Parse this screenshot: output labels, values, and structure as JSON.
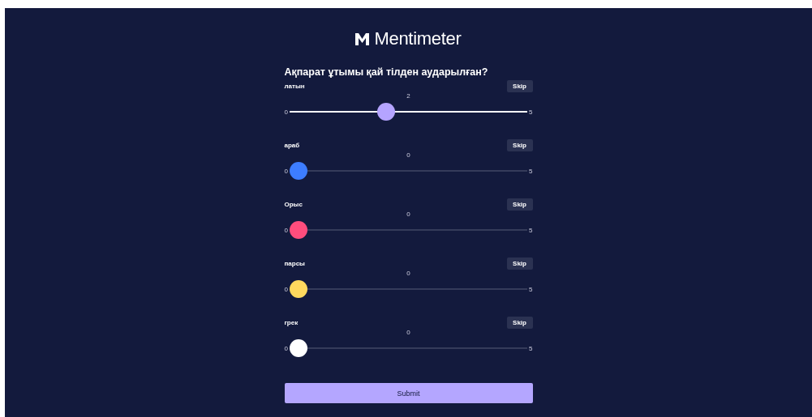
{
  "logo": {
    "text": "Mentimeter"
  },
  "question": "Ақпарат ұтымы қай тілден аударылған?",
  "sliders": [
    {
      "label": "латын",
      "skip": "Skip",
      "value": "2",
      "min": "0",
      "max": "5",
      "level": 0.4,
      "touched": true,
      "color": "#b5a4ff"
    },
    {
      "label": "араб",
      "skip": "Skip",
      "value": "0",
      "min": "0",
      "max": "5",
      "level": 0,
      "touched": false,
      "color": "#3d7dff"
    },
    {
      "label": "Орыс",
      "skip": "Skip",
      "value": "0",
      "min": "0",
      "max": "5",
      "level": 0,
      "touched": false,
      "color": "#ff4d7d"
    },
    {
      "label": "парсы",
      "skip": "Skip",
      "value": "0",
      "min": "0",
      "max": "5",
      "level": 0,
      "touched": false,
      "color": "#ffd95e"
    },
    {
      "label": "грек",
      "skip": "Skip",
      "value": "0",
      "min": "0",
      "max": "5",
      "level": 0,
      "touched": false,
      "color": "#ffffff"
    }
  ],
  "submit": "Submit"
}
